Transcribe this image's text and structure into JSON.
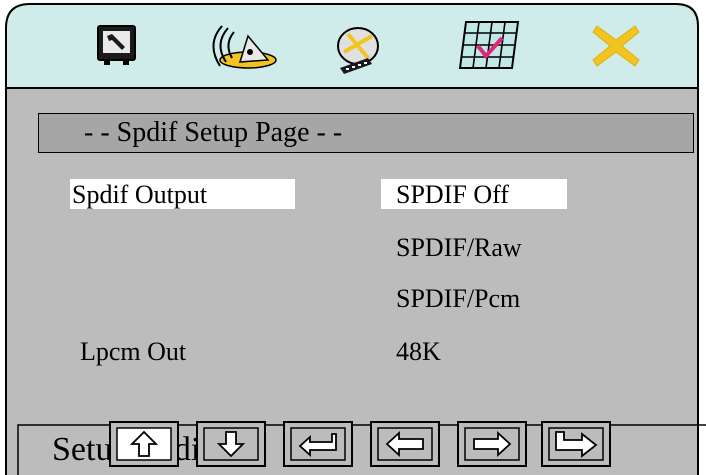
{
  "header": {
    "icons": [
      {
        "name": "general-setup-icon"
      },
      {
        "name": "audio-setup-icon"
      },
      {
        "name": "video-setup-icon"
      },
      {
        "name": "preference-setup-icon"
      },
      {
        "name": "exit-setup-icon"
      }
    ]
  },
  "page": {
    "title": "- - Spdif Setup Page - -"
  },
  "menu": {
    "spdif_output_label": "Spdif Output",
    "spdif_options": [
      "SPDIF Off",
      "SPDIF/Raw",
      "SPDIF/Pcm"
    ],
    "lpcm_out_label": "Lpcm Out",
    "lpcm_out_value": "48K"
  },
  "footer": {
    "status_text": "Setup Spdif",
    "nav_buttons": [
      "up-arrow-icon",
      "down-arrow-icon",
      "enter-icon",
      "left-arrow-icon",
      "right-arrow-icon",
      "right-end-arrow-icon"
    ]
  },
  "colors": {
    "header_bg": "#cfeceb",
    "body_bg": "#bdbcbc",
    "title_bar_bg": "#a7a6a6",
    "highlight": "#ffffff",
    "check_mark": "#e0277e"
  }
}
